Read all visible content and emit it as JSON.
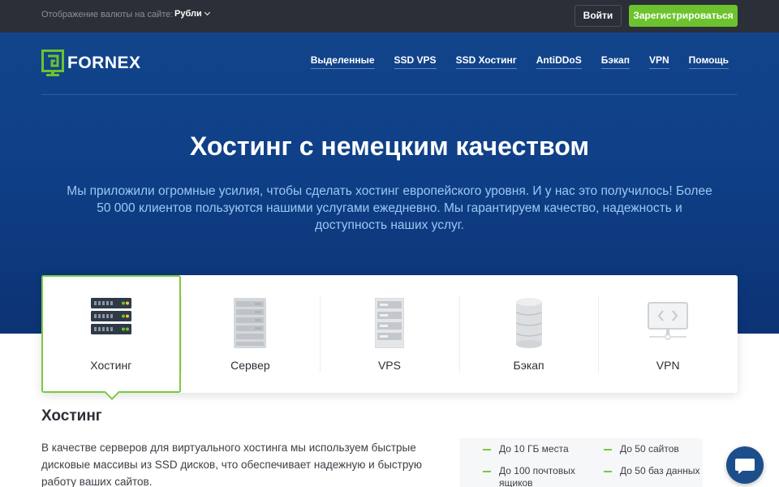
{
  "topbar": {
    "currency_label": "Отображение валюты на сайте:",
    "currency_value": "Рубли",
    "login_label": "Войти",
    "register_label": "Зарегистрироваться"
  },
  "brand": {
    "name": "FORNEX",
    "accent": "#6cc32e"
  },
  "nav": {
    "items": [
      "Выделенные",
      "SSD VPS",
      "SSD Хостинг",
      "AntiDDoS",
      "Бэкап",
      "VPN",
      "Помощь"
    ]
  },
  "hero": {
    "title": "Хостинг с немецким качеством",
    "lead": "Мы приложили огромные усилия, чтобы сделать хостинг европейского уровня. И у нас это получилось! Более 50 000 клиентов пользуются нашими услугами ежедневно. Мы гарантируем качество, надежность и доступность наших услуг."
  },
  "services": {
    "active_index": 0,
    "tabs": [
      {
        "label": "Хостинг",
        "icon": "server-stack-icon"
      },
      {
        "label": "Сервер",
        "icon": "server-tower-icon"
      },
      {
        "label": "VPS",
        "icon": "vps-rack-icon"
      },
      {
        "label": "Бэкап",
        "icon": "database-icon"
      },
      {
        "label": "VPN",
        "icon": "monitor-code-icon"
      }
    ]
  },
  "content": {
    "title": "Хостинг",
    "text": "В качестве серверов для виртуального хостинга мы используем быстрые дисковые массивы из SSD дисков, что обеспечивает надежную и быструю работу ваших сайтов.",
    "features": [
      "До 10 ГБ места",
      "До 50 сайтов",
      "До 100 почтовых ящиков",
      "До 50 баз данных"
    ]
  },
  "chat": {
    "icon": "chat-bubble-icon"
  }
}
